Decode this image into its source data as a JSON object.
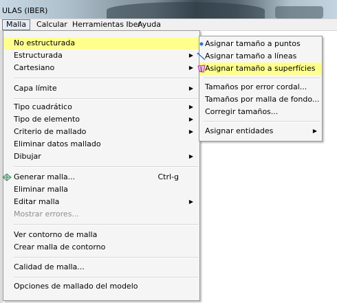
{
  "window": {
    "title": "ULAS (IBER)"
  },
  "menubar": [
    "Malla",
    "Calcular",
    "Herramientas Iber",
    "Ayuda"
  ],
  "menu": {
    "items": [
      {
        "label": "No estructurada",
        "has_submenu": true,
        "highlighted": true
      },
      {
        "label": "Estructurada",
        "has_submenu": true
      },
      {
        "label": "Cartesiano",
        "has_submenu": true
      },
      {
        "label": "Capa límite",
        "has_submenu": true
      },
      {
        "label": "Tipo cuadrático",
        "has_submenu": true
      },
      {
        "label": "Tipo de elemento",
        "has_submenu": true
      },
      {
        "label": "Criterio de mallado",
        "has_submenu": true
      },
      {
        "label": "Eliminar datos mallado"
      },
      {
        "label": "Dibujar",
        "has_submenu": true
      },
      {
        "label": "Generar malla...",
        "shortcut": "Ctrl-g",
        "icon": "mesh-icon"
      },
      {
        "label": "Eliminar malla"
      },
      {
        "label": "Editar malla",
        "has_submenu": true
      },
      {
        "label": "Mostrar errores...",
        "disabled": true
      },
      {
        "label": "Ver contorno de malla"
      },
      {
        "label": "Crear malla de contorno"
      },
      {
        "label": "Calidad de malla..."
      },
      {
        "label": "Opciones de mallado del modelo"
      }
    ]
  },
  "submenu": {
    "items": [
      {
        "label": "Asignar tamaño a puntos",
        "icon": "point-icon"
      },
      {
        "label": "Asignar tamaño a líneas",
        "icon": "line-icon"
      },
      {
        "label": "Asignar tamaño a superfícies",
        "icon": "surface-icon",
        "highlighted": true
      },
      {
        "label": "Tamaños por error cordal..."
      },
      {
        "label": "Tamaños por malla de fondo..."
      },
      {
        "label": "Corregir tamaños..."
      },
      {
        "label": "Asignar entidades",
        "has_submenu": true
      }
    ]
  },
  "colors": {
    "highlight": "#ffff8e",
    "menu_bg": "#f5f5f5"
  }
}
